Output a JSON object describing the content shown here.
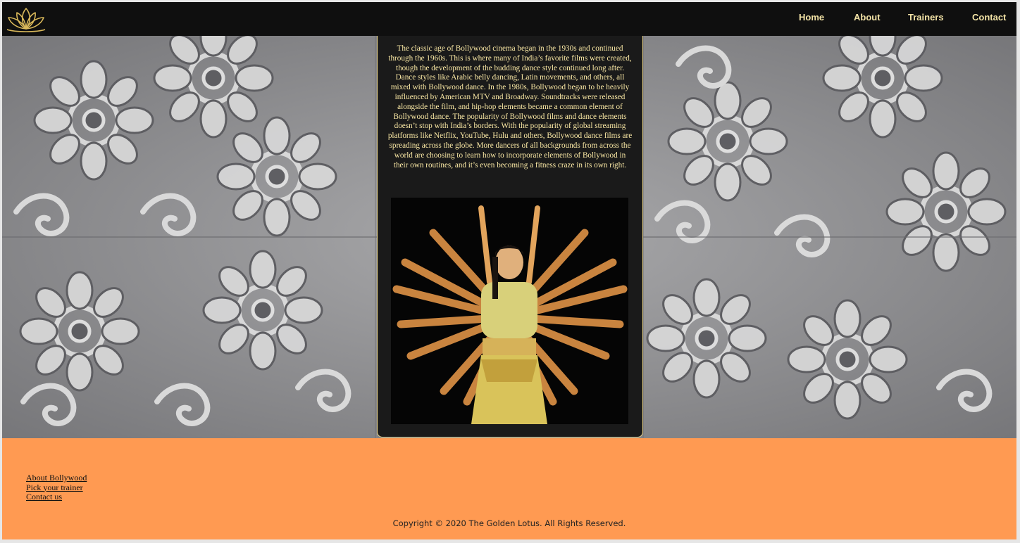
{
  "brand": {
    "logo_icon": "lotus-icon"
  },
  "nav": {
    "home": "Home",
    "about": "About",
    "trainers": "Trainers",
    "contact": "Contact"
  },
  "article": {
    "text": "The classic age of Bollywood cinema began in the 1930s and continued through the 1960s. This is where many of India’s favorite films were created, though the development of the budding dance style continued long after. Dance styles like Arabic belly dancing, Latin movements, and others, all mixed with Bollywood dance. In the 1980s, Bollywood began to be heavily influenced by American MTV and Broadway. Soundtracks were released alongside the film, and hip-hop elements became a common element of Bollywood dance. The popularity of Bollywood films and dance elements doesn’t stop with India’s borders. With the popularity of global streaming platforms like Netflix, YouTube, Hulu and others, Bollywood dance films are spreading across the globe. More dancers of all backgrounds from across the world are choosing to learn how to incorporate elements of Bollywood in their own routines, and it’s even becoming a fitness craze in its own right.",
    "image_icon": "dancer-image"
  },
  "footer": {
    "links": [
      "About Bollywood",
      "Pick your trainer",
      "Contact us"
    ],
    "copyright": "Copyright © 2020 The Golden Lotus. All Rights Reserved."
  },
  "colors": {
    "nav_bg": "#0f0f0f",
    "accent_gold": "#f3e3a6",
    "footer_bg": "#ff9a52",
    "panel_bg": "#1a1a1a"
  }
}
